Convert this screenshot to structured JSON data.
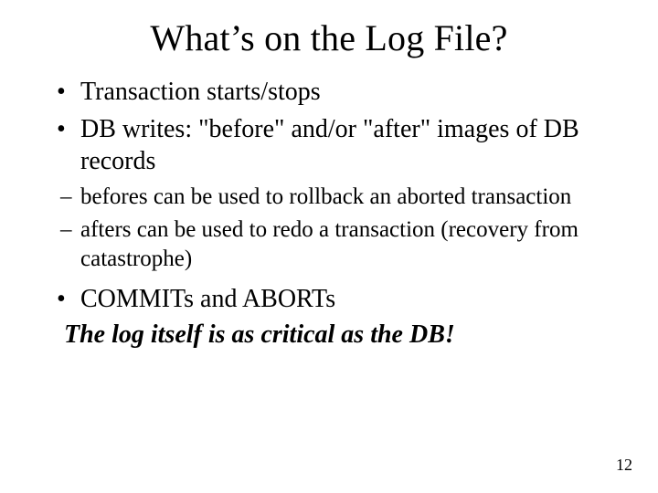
{
  "title": "What’s on the Log File?",
  "bullets": [
    {
      "text": "Transaction starts/stops"
    },
    {
      "text": "DB writes: \"before\" and/or \"after\" images of DB records"
    }
  ],
  "sub_bullets": [
    {
      "text": "befores can be used to rollback an aborted transaction"
    },
    {
      "text": "afters can be used to redo a transaction (recovery from catastrophe)"
    }
  ],
  "bullets2": [
    {
      "text": "COMMITs and ABORTs"
    }
  ],
  "emphasis": "The log itself is as critical as the DB!",
  "page_number": "12"
}
